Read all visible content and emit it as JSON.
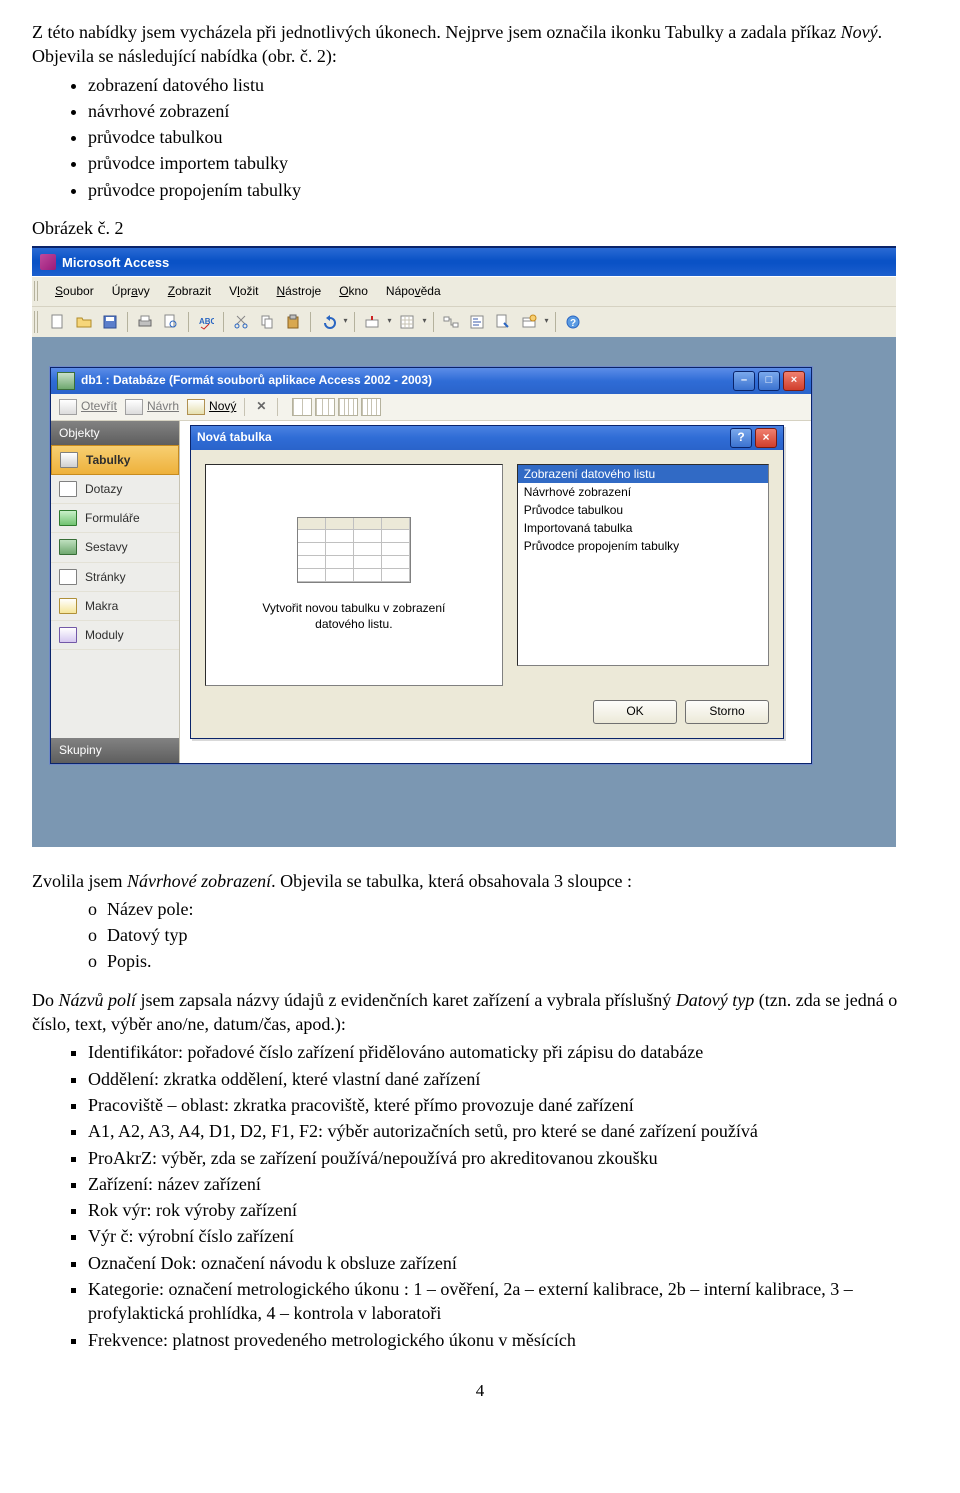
{
  "para1_a": "Z této nabídky jsem vycházela při jednotlivých úkonech. Nejprve jsem označila ikonku Tabulky a zadala příkaz ",
  "para1_b": "Nový",
  "para1_c": ". Objevila se následující nabídka (obr. č. 2):",
  "bullets1": [
    "zobrazení datového listu",
    "návrhové zobrazení",
    "průvodce tabulkou",
    "průvodce importem tabulky",
    "průvodce propojením tabulky"
  ],
  "caption1": "Obrázek č. 2",
  "screenshot": {
    "appTitle": "Microsoft Access",
    "menus": [
      {
        "pre": "",
        "u": "S",
        "post": "oubor"
      },
      {
        "pre": "Úpr",
        "u": "a",
        "post": "vy"
      },
      {
        "pre": "",
        "u": "Z",
        "post": "obrazit"
      },
      {
        "pre": "V",
        "u": "l",
        "post": "ožit"
      },
      {
        "pre": "",
        "u": "N",
        "post": "ástroje"
      },
      {
        "pre": "",
        "u": "O",
        "post": "kno"
      },
      {
        "pre": "Nápo",
        "u": "v",
        "post": "ěda"
      }
    ],
    "dbwinTitle": "db1 : Databáze (Formát souborů aplikace Access 2002 - 2003)",
    "dbToolbar": {
      "open": "Otevřít",
      "design": "Návrh",
      "new": "Nový"
    },
    "sidebar": {
      "header1": "Objekty",
      "items": [
        "Tabulky",
        "Dotazy",
        "Formuláře",
        "Sestavy",
        "Stránky",
        "Makra",
        "Moduly"
      ],
      "header2": "Skupiny"
    },
    "dialog": {
      "title": "Nová tabulka",
      "previewText1": "Vytvořit novou tabulku v zobrazení",
      "previewText2": "datového listu.",
      "list": [
        "Zobrazení datového listu",
        "Návrhové zobrazení",
        "Průvodce tabulkou",
        "Importovaná tabulka",
        "Průvodce propojením tabulky"
      ],
      "ok": "OK",
      "cancel": "Storno"
    }
  },
  "para2_a": "Zvolila jsem ",
  "para2_b": "Návrhové zobrazení",
  "para2_c": ". Objevila se tabulka, která obsahovala 3 sloupce :",
  "olist": [
    "Název pole:",
    "Datový typ",
    "Popis."
  ],
  "para3_a": "Do ",
  "para3_b": "Názvů polí",
  "para3_c": " jsem zapsala názvy údajů z evidenčních karet zařízení a vybrala příslušný ",
  "para3_d": "Datový typ",
  "para3_e": " (tzn. zda se jedná o číslo, text, výběr ano/ne, datum/čas, apod.):",
  "fields": [
    "Identifikátor: pořadové číslo zařízení přidělováno automaticky při zápisu do databáze",
    "Oddělení: zkratka oddělení, které vlastní dané zařízení",
    "Pracoviště – oblast: zkratka pracoviště, které přímo provozuje dané zařízení",
    "A1, A2, A3, A4, D1, D2, F1, F2: výběr autorizačních setů, pro které se dané zařízení používá",
    "ProAkrZ: výběr, zda se zařízení používá/nepoužívá pro akreditovanou zkoušku",
    "Zařízení: název zařízení",
    "Rok výr: rok výroby zařízení",
    "Výr č: výrobní číslo zařízení",
    "Označení Dok: označení návodu k obsluze zařízení",
    "Kategorie: označení metrologického úkonu : 1 – ověření, 2a – externí kalibrace, 2b – interní kalibrace, 3 – profylaktická prohlídka, 4 – kontrola v laboratoři",
    "Frekvence: platnost provedeného metrologického úkonu v měsících"
  ],
  "pageNum": "4"
}
